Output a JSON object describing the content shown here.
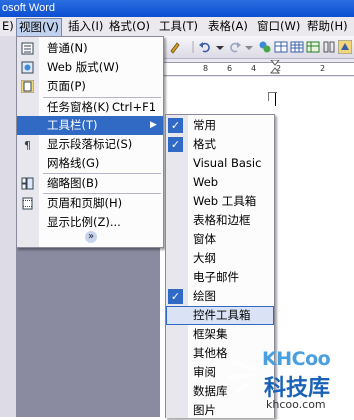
{
  "title": "osoft Word",
  "menubar": [
    "E)",
    "视图(V)",
    "插入(I)",
    "格式(O)",
    "工具(T)",
    "表格(A)",
    "窗口(W)",
    "帮助(H)"
  ],
  "ruler_numbers": [
    "8",
    "6",
    "4",
    "2",
    "2"
  ],
  "view_menu": {
    "items": [
      {
        "label": "普通(N)"
      },
      {
        "label": "Web 版式(W)"
      },
      {
        "label": "页面(P)"
      },
      {
        "label": "任务窗格(K)",
        "shortcut": "Ctrl+F1"
      },
      {
        "label": "工具栏(T)"
      },
      {
        "label": "显示段落标记(S)"
      },
      {
        "label": "网格线(G)"
      },
      {
        "label": "缩略图(B)"
      },
      {
        "label": "页眉和页脚(H)"
      },
      {
        "label": "显示比例(Z)..."
      }
    ],
    "expand": "»"
  },
  "toolbars_menu": {
    "items": [
      {
        "label": "常用",
        "checked": true
      },
      {
        "label": "格式",
        "checked": true
      },
      {
        "label": "Visual Basic",
        "checked": false
      },
      {
        "label": "Web",
        "checked": false
      },
      {
        "label": "Web 工具箱",
        "checked": false
      },
      {
        "label": "表格和边框",
        "checked": false
      },
      {
        "label": "窗体",
        "checked": false
      },
      {
        "label": "大纲",
        "checked": false
      },
      {
        "label": "电子邮件",
        "checked": false
      },
      {
        "label": "绘图",
        "checked": true
      },
      {
        "label": "控件工具箱",
        "checked": false
      },
      {
        "label": "框架集",
        "checked": false
      },
      {
        "label": "其他格",
        "checked": false
      },
      {
        "label": "审阅",
        "checked": false
      },
      {
        "label": "数据库",
        "checked": false
      },
      {
        "label": "图片",
        "checked": false
      }
    ],
    "check_glyph": "✓"
  },
  "watermark": {
    "brand": "KHCoo",
    "name": "科技库",
    "url": "khcoo.com"
  },
  "colors": {
    "highlight": "#316ac5",
    "title": "#0c4fd1"
  }
}
